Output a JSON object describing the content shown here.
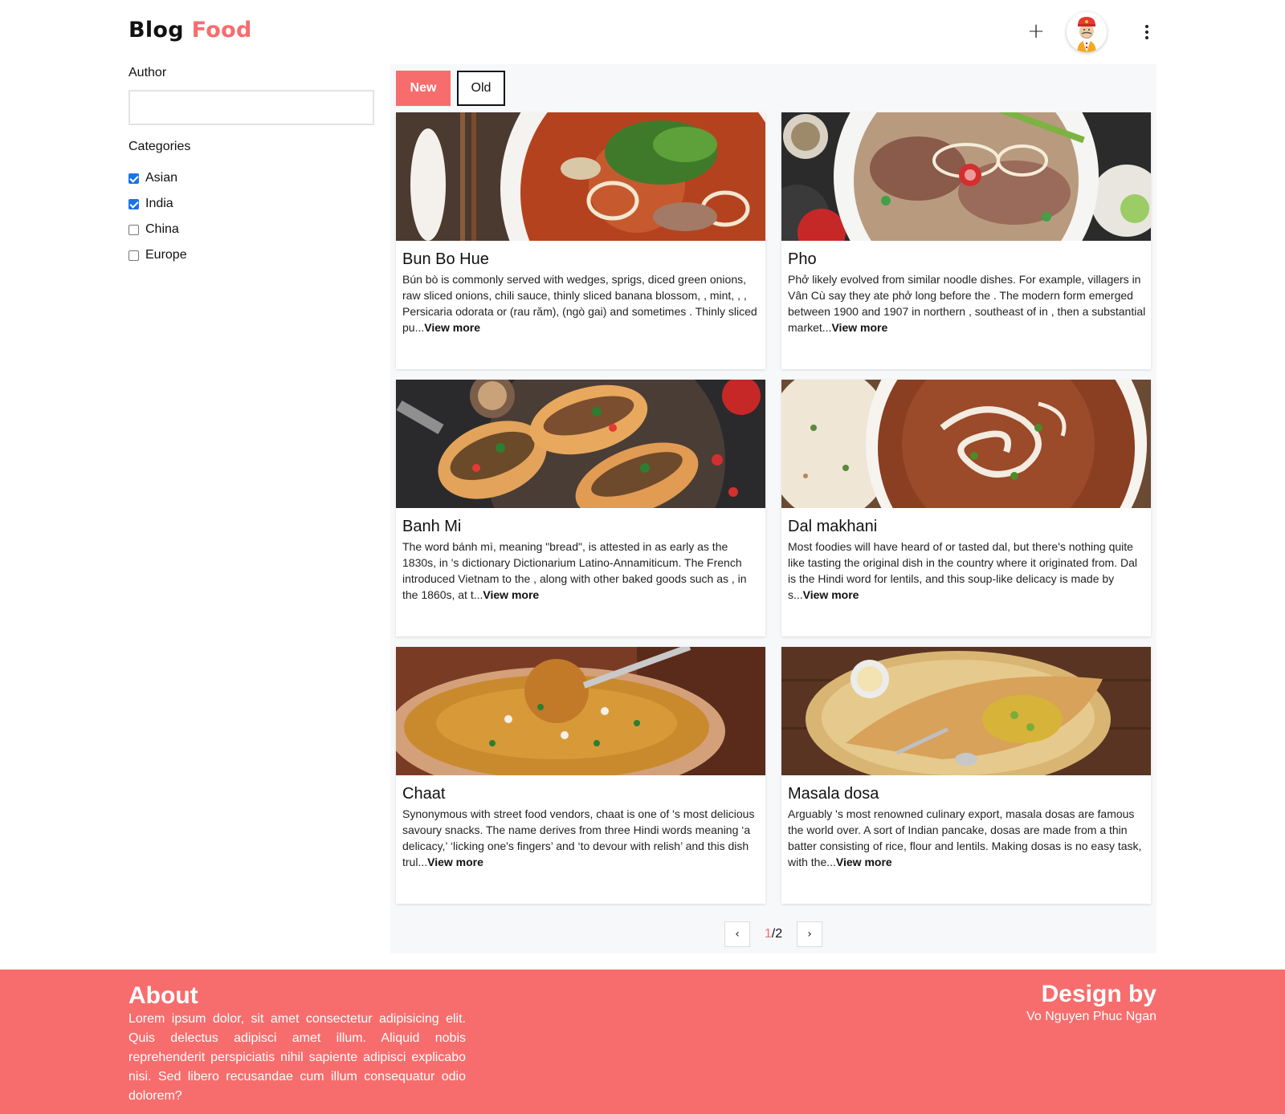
{
  "header": {
    "logo_part1": "Blog",
    "logo_part2": "Food",
    "add_icon": "+",
    "avatar_alt": "user-avatar",
    "menu_icon": "more-vertical-icon"
  },
  "sidebar": {
    "author_label": "Author",
    "author_value": "",
    "categories_label": "Categories",
    "categories": [
      {
        "label": "Asian",
        "checked": true
      },
      {
        "label": "India",
        "checked": true
      },
      {
        "label": "China",
        "checked": false
      },
      {
        "label": "Europe",
        "checked": false
      }
    ]
  },
  "sort": {
    "new_label": "New",
    "old_label": "Old"
  },
  "posts": [
    {
      "title": "Bun Bo Hue",
      "excerpt": "Bún bò is commonly served with  wedges,  sprigs, diced green onions, raw sliced onions, chili sauce, thinly sliced banana blossom, , mint, , , Persicaria odorata or  (rau răm),  (ngò gai) and sometimes . Thinly sliced pu...",
      "more": "View more"
    },
    {
      "title": "Pho",
      "excerpt": "Phở likely evolved from similar noodle dishes. For example, villagers in Vân Cù say they ate phở long before the . The modern form emerged between 1900 and 1907 in northern , southeast of  in , then a substantial  market...",
      "more": "View more"
    },
    {
      "title": "Banh Mi",
      "excerpt": "The word bánh mì, meaning \"bread\", is attested in  as early as the 1830s, in 's dictionary Dictionarium Latino-Annamiticum. The French introduced Vietnam to the , along with other baked goods such as , in the 1860s, at t...",
      "more": "View more"
    },
    {
      "title": "Dal makhani",
      "excerpt": "Most foodies will have heard of or tasted dal, but there's nothing quite like tasting the original dish in the country where it originated from. Dal is the Hindi word for lentils, and this soup-like delicacy is made by s...",
      "more": "View more"
    },
    {
      "title": "Chaat",
      "excerpt": "Synonymous with  street food vendors, chaat is one of 's most delicious savoury snacks. The name derives from three Hindi words meaning ‘a delicacy,’ ‘licking one's fingers’ and ‘to devour with relish’ and this dish trul...",
      "more": "View more"
    },
    {
      "title": "Masala dosa",
      "excerpt": "Arguably 's most renowned culinary export, masala dosas are famous the world over. A sort of Indian pancake, dosas are made from a thin batter consisting of rice, flour and lentils. Making dosas is no easy task, with the...",
      "more": "View more"
    }
  ],
  "pagination": {
    "prev_icon": "chevron-left-icon",
    "next_icon": "chevron-right-icon",
    "current": "1",
    "total": "/2"
  },
  "footer": {
    "about_title": "About",
    "about_text": "Lorem ipsum dolor, sit amet consectetur adipisicing elit. Quis delectus adipisci amet illum. Aliquid nobis reprehenderit perspiciatis nihil sapiente adipisci explicabo nisi. Sed libero recusandae cum illum consequatur odio dolorem?",
    "design_title": "Design by",
    "designer": "Vo Nguyen Phuc Ngan"
  },
  "colors": {
    "accent": "#f76d6d",
    "checkbox": "#1a73e8",
    "panel_bg": "#f7f8fa"
  }
}
